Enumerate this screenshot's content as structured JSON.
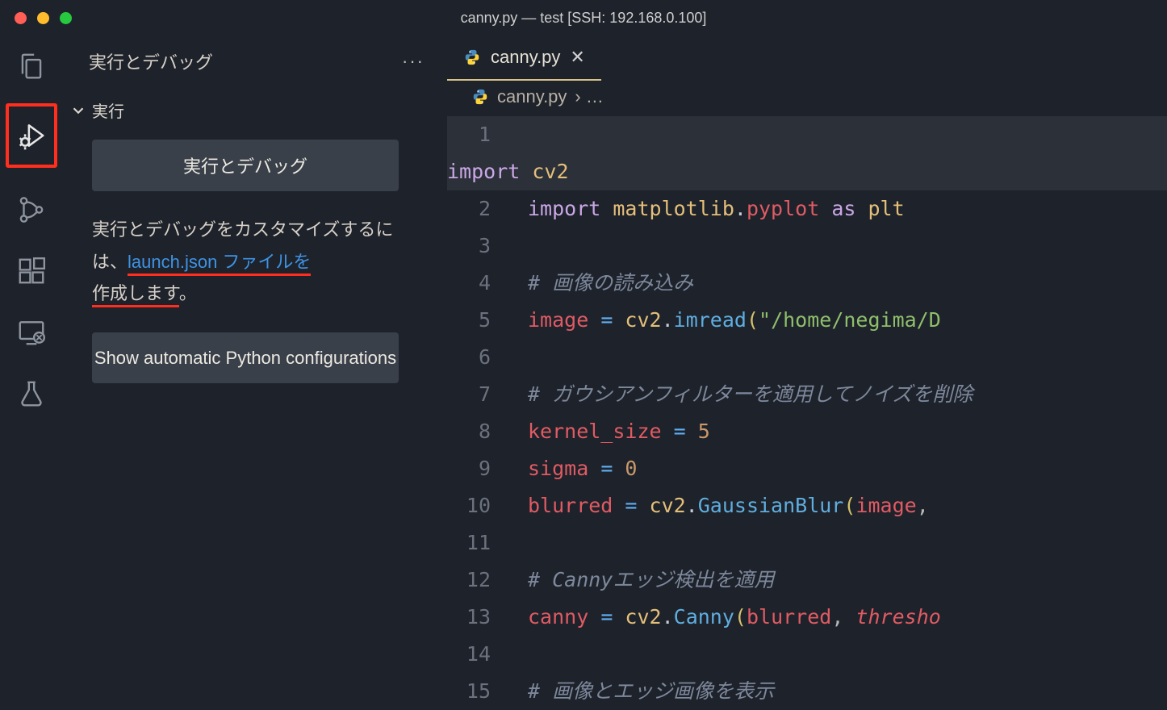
{
  "window": {
    "title": "canny.py — test [SSH: 192.168.0.100]"
  },
  "sidebar": {
    "header": "実行とデバッグ",
    "run_section": "実行",
    "run_debug_btn": "実行とデバッグ",
    "desc_pre": "実行とデバッグをカスタマイズするには、",
    "desc_link": "launch.json ファイルを",
    "desc_post1": "作成します",
    "desc_post2": "。",
    "show_cfg_btn": "Show automatic Python configurations"
  },
  "tab": {
    "filename": "canny.py"
  },
  "breadcrumb": {
    "file": "canny.py",
    "rest": "› …"
  },
  "code": {
    "l1_import": "import",
    "l1_mod": "cv2",
    "l2_import": "import",
    "l2_mod": "matplotlib",
    "l2_dot": ".",
    "l2_sub": "pyplot",
    "l2_as": "as",
    "l2_alias": "plt",
    "l4_cmt": "# 画像の読み込み",
    "l5_var": "image",
    "l5_eq": " = ",
    "l5_obj": "cv2",
    "l5_fn": "imread",
    "l5_str": "\"/home/negima/D",
    "l7_cmt": "# ガウシアンフィルターを適用してノイズを削除",
    "l8_var": "kernel_size",
    "l8_eq": " = ",
    "l8_num": "5",
    "l9_var": "sigma",
    "l9_eq": " = ",
    "l9_num": "0",
    "l10_var": "blurred",
    "l10_eq": " = ",
    "l10_obj": "cv2",
    "l10_fn": "GaussianBlur",
    "l10_arg1": "image",
    "l10_comma": ", ",
    "l12_cmt": "# Cannyエッジ検出を適用",
    "l13_var": "canny",
    "l13_eq": " = ",
    "l13_obj": "cv2",
    "l13_fn": "Canny",
    "l13_arg1": "blurred",
    "l13_arg2": "thresho",
    "l15_cmt": "# 画像とエッジ画像を表示"
  },
  "line_numbers": [
    "1",
    "2",
    "3",
    "4",
    "5",
    "6",
    "7",
    "8",
    "9",
    "10",
    "11",
    "12",
    "13",
    "14",
    "15"
  ]
}
